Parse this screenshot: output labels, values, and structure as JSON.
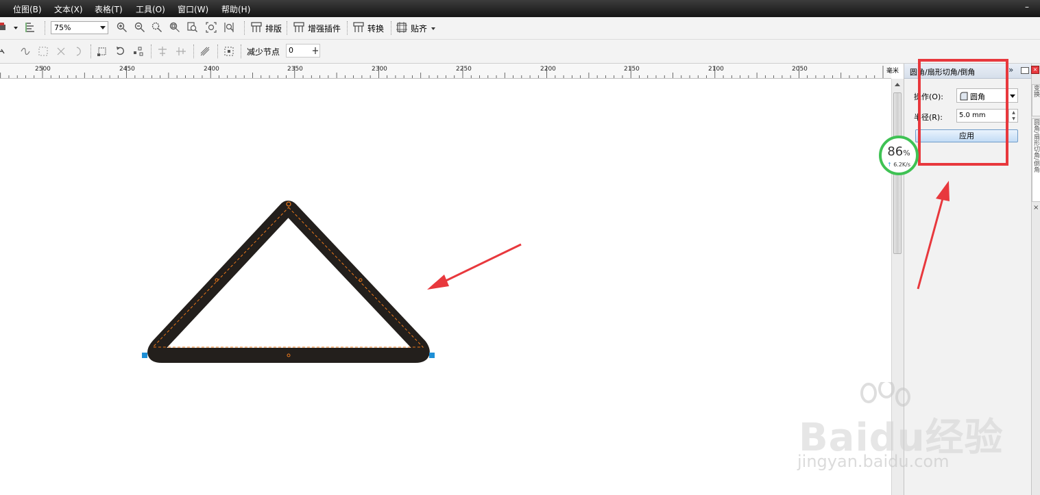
{
  "menu": {
    "items": [
      "位图(B)",
      "文本(X)",
      "表格(T)",
      "工具(O)",
      "窗口(W)",
      "帮助(H)"
    ]
  },
  "toolbar": {
    "zoom_value": "75%",
    "buttons": [
      "排版",
      "增强插件",
      "转换",
      "贴齐"
    ]
  },
  "property_bar": {
    "reduce_nodes_label": "减少节点",
    "reduce_nodes_value": "0"
  },
  "ruler": {
    "labels": [
      "2500",
      "2450",
      "2400",
      "2350",
      "2300",
      "2250",
      "2200",
      "2150",
      "2100",
      "2050"
    ],
    "unit": "毫米"
  },
  "docker": {
    "title": "圆角/扇形切角/倒角",
    "operation_label": "操作(O):",
    "operation_value": "圆角",
    "radius_label": "半径(R):",
    "radius_value": "5.0 mm",
    "apply_label": "应用",
    "side_tab_labels": [
      "变换",
      "圆角/扇形切角/倒角"
    ]
  },
  "speed_widget": {
    "percent": "86",
    "percent_sign": "%",
    "rate": "6.2K/s"
  },
  "watermark": {
    "brand": "Baidu经验",
    "url": "jingyan.baidu.com"
  },
  "colors": {
    "annotation_red": "#e8383d",
    "triangle_outline": "#231f1c",
    "node_orange": "#f07a1a",
    "selection_handle": "#1e8fd6",
    "speed_green": "#3fc254"
  }
}
